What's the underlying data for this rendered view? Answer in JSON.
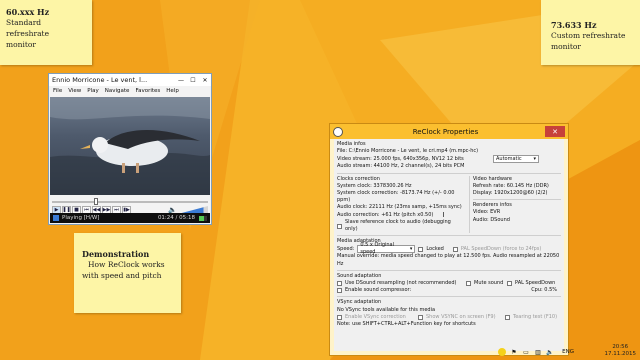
{
  "colors": {
    "desktop": "#f3a21a",
    "accent": "#fbbf2f",
    "close": "#c7413a",
    "sticky": "#fdf5a6"
  },
  "notes": {
    "left": {
      "line1": "60.xxx Hz",
      "line2": "Standard refreshrate",
      "line3": "monitor"
    },
    "right": {
      "line1": "73.633 Hz",
      "line2": "Custom refreshrate",
      "line3": "monitor"
    },
    "demo": {
      "line1": "Demonstration",
      "line2": "How ReClock works",
      "line3": "with speed and pitch"
    }
  },
  "player": {
    "title": "Ennio Morricone - Le vent, l...",
    "window_buttons": {
      "min": "—",
      "max": "☐",
      "close": "✕"
    },
    "menu": [
      "File",
      "View",
      "Play",
      "Navigate",
      "Favorites",
      "Help"
    ],
    "status": "Playing [H/W]",
    "time": "01:24 / 05:18",
    "seek_progress": 0.27,
    "volume_level": 0.85
  },
  "reclock": {
    "title": "ReClock Properties",
    "close": "✕",
    "media_infos": {
      "header": "Media infos",
      "file": "File:  C:\\Ennio Morricone - Le vent, le cri.mp4 (m.mpc-hc)",
      "video": "Video stream:  25.000 fps, 640x356p, NV12 12 bits",
      "audio": "Audio stream:  44100 Hz, 2 channel(s), 24 bits PCM",
      "mode": "Automatic"
    },
    "clocks": {
      "header": "Clocks correction",
      "system_clock": "System clock:  3378300.26 Hz",
      "system_correction": "System clock correction:  -8173.74 Hz (+/- 0.00 ppm)",
      "audio_clock": "Audio clock:  22111 Hz (23ms samp, +15ms sync)",
      "audio_correction": "Audio correction:  +61 Hz (pitch x0.50)",
      "slave": "Slave reference clock to audio (debugging only)"
    },
    "video_hw": {
      "header": "Video hardware",
      "refresh": "Refresh rate:  60.145 Hz (DDR)",
      "display": "Display:  1920x1200@60 (2/2)"
    },
    "renderers": {
      "header": "Renderers infos",
      "video": "Video: EVR",
      "audio": "Audio: DSound"
    },
    "adaptation": {
      "header": "Media adaptation",
      "speed_label": "Speed:",
      "speed_value": "0.5 x Original speed",
      "locked": "Locked",
      "pal": "PAL SpeedDown (force to 24fps)",
      "override": "Manual override: media speed changed to play at 12.500 fps. Audio resampled at 22050 Hz"
    },
    "sound": {
      "header": "Sound adaptation",
      "resampling": "Use DSound resampling (not recommended)",
      "mute": "Mute sound",
      "pal": "PAL SpeedDown",
      "compressor": "Enable sound compressor:",
      "cpu": "Cpu: 0.5%"
    },
    "vsync": {
      "header": "VSync adaptation",
      "none": "No VSync tools available for this media",
      "enable": "Enable VSync correction",
      "show": "Show VSYNC on screen (F9)",
      "tearing": "Tearing test (F10)",
      "note": "Note: use SHIFT+CTRL+ALT+Function key for shortcuts"
    }
  },
  "taskbar": {
    "lang": "ENG",
    "time": "20:56",
    "date": "17.11.2015"
  }
}
